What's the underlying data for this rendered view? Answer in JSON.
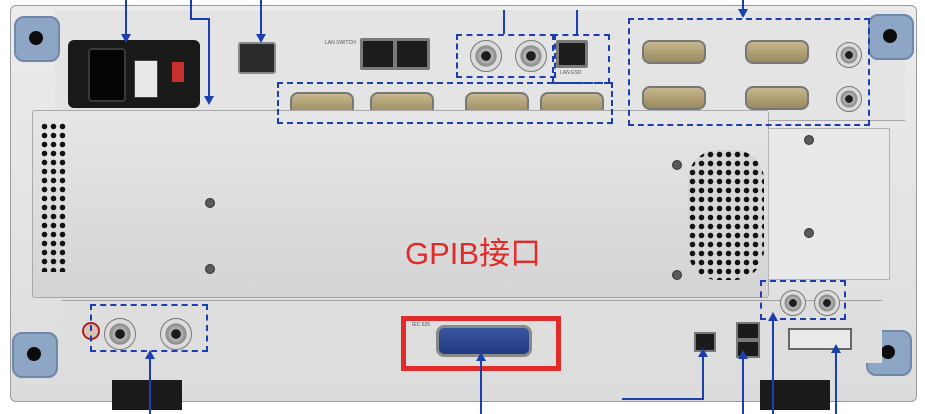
{
  "annotation": {
    "gpib_label": "GPIB接口",
    "highlight_color": "#e02b2b",
    "callout_color": "#1c3fae"
  },
  "panel": {
    "upper_labels": {
      "lan_switch": "LAN SWITCH",
      "lan_esd": "LAN ESD",
      "gpib_port_label": "IEC 625"
    }
  }
}
